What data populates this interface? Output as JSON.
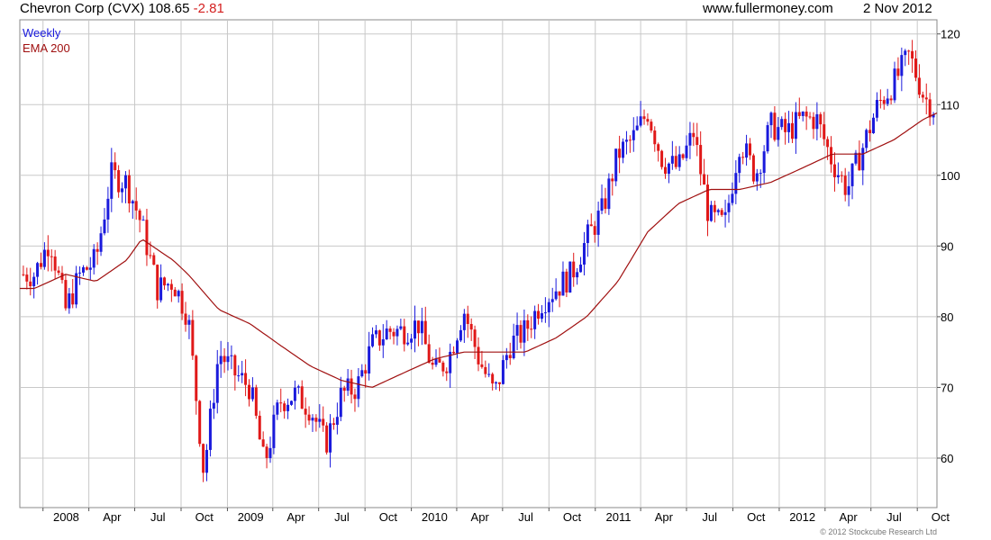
{
  "header": {
    "title": "Chevron Corp (CVX)",
    "price": "108.65",
    "change": "-2.81",
    "source": "www.fullermoney.com",
    "date": "2 Nov 2012"
  },
  "legend": {
    "period": "Weekly",
    "ema": "EMA 200"
  },
  "copyright": "© 2012 Stockcube Research Ltd",
  "colors": {
    "up": "#1a1adc",
    "down": "#e01818",
    "ema": "#a01010",
    "grid": "#c8c8c8",
    "title_change": "#d42020"
  },
  "chart_data": {
    "type": "candlestick",
    "title": "Chevron Corp (CVX)",
    "period": "Weekly",
    "x_tick_labels": [
      "2008",
      "Apr",
      "Jul",
      "Oct",
      "2009",
      "Apr",
      "Jul",
      "Oct",
      "2010",
      "Apr",
      "Jul",
      "Oct",
      "2011",
      "Apr",
      "Jul",
      "Oct",
      "2012",
      "Apr",
      "Jul",
      "Oct"
    ],
    "y_ticks": [
      60,
      70,
      80,
      90,
      100,
      110,
      120
    ],
    "ylim": [
      53,
      122
    ],
    "grid": true,
    "y_axis_side": "right",
    "legend_position": "top-left",
    "close_approx": [
      {
        "x": "2007-12",
        "y": 86
      },
      {
        "x": "2008-01",
        "y": 91
      },
      {
        "x": "2008-02",
        "y": 81
      },
      {
        "x": "2008-03",
        "y": 86
      },
      {
        "x": "2008-04",
        "y": 88
      },
      {
        "x": "2008-05",
        "y": 100
      },
      {
        "x": "2008-06",
        "y": 99
      },
      {
        "x": "2008-07",
        "y": 93
      },
      {
        "x": "2008-08",
        "y": 84
      },
      {
        "x": "2008-09",
        "y": 85
      },
      {
        "x": "2008-10",
        "y": 80
      },
      {
        "x": "2008-11",
        "y": 58
      },
      {
        "x": "2008-12",
        "y": 75
      },
      {
        "x": "2009-01",
        "y": 72
      },
      {
        "x": "2009-02",
        "y": 70
      },
      {
        "x": "2009-03",
        "y": 59
      },
      {
        "x": "2009-04",
        "y": 68
      },
      {
        "x": "2009-05",
        "y": 69
      },
      {
        "x": "2009-06",
        "y": 67
      },
      {
        "x": "2009-07",
        "y": 62
      },
      {
        "x": "2009-08",
        "y": 69
      },
      {
        "x": "2009-09",
        "y": 70
      },
      {
        "x": "2009-10",
        "y": 76
      },
      {
        "x": "2009-11",
        "y": 78
      },
      {
        "x": "2009-12",
        "y": 78
      },
      {
        "x": "2010-01",
        "y": 79
      },
      {
        "x": "2010-02",
        "y": 72
      },
      {
        "x": "2010-03",
        "y": 74
      },
      {
        "x": "2010-04",
        "y": 81
      },
      {
        "x": "2010-05",
        "y": 74
      },
      {
        "x": "2010-06",
        "y": 69
      },
      {
        "x": "2010-07",
        "y": 76
      },
      {
        "x": "2010-08",
        "y": 78
      },
      {
        "x": "2010-09",
        "y": 82
      },
      {
        "x": "2010-10",
        "y": 84
      },
      {
        "x": "2010-11",
        "y": 86
      },
      {
        "x": "2010-12",
        "y": 91
      },
      {
        "x": "2011-01",
        "y": 95
      },
      {
        "x": "2011-02",
        "y": 103
      },
      {
        "x": "2011-03",
        "y": 105
      },
      {
        "x": "2011-04",
        "y": 109
      },
      {
        "x": "2011-05",
        "y": 102
      },
      {
        "x": "2011-06",
        "y": 101
      },
      {
        "x": "2011-07",
        "y": 106
      },
      {
        "x": "2011-08",
        "y": 94
      },
      {
        "x": "2011-09",
        "y": 93
      },
      {
        "x": "2011-10",
        "y": 105
      },
      {
        "x": "2011-11",
        "y": 100
      },
      {
        "x": "2011-12",
        "y": 107
      },
      {
        "x": "2012-01",
        "y": 106
      },
      {
        "x": "2012-02",
        "y": 108
      },
      {
        "x": "2012-03",
        "y": 108
      },
      {
        "x": "2012-04",
        "y": 102
      },
      {
        "x": "2012-05",
        "y": 98
      },
      {
        "x": "2012-06",
        "y": 104
      },
      {
        "x": "2012-07",
        "y": 110
      },
      {
        "x": "2012-08",
        "y": 113
      },
      {
        "x": "2012-09",
        "y": 117
      },
      {
        "x": "2012-10",
        "y": 111
      },
      {
        "x": "2012-11",
        "y": 108.65
      }
    ],
    "ema200_approx": [
      {
        "x": "2007-12",
        "y": 84
      },
      {
        "x": "2008-02",
        "y": 86
      },
      {
        "x": "2008-04",
        "y": 85
      },
      {
        "x": "2008-06",
        "y": 88
      },
      {
        "x": "2008-07",
        "y": 91
      },
      {
        "x": "2008-09",
        "y": 88
      },
      {
        "x": "2008-10",
        "y": 86
      },
      {
        "x": "2008-12",
        "y": 81
      },
      {
        "x": "2009-02",
        "y": 79
      },
      {
        "x": "2009-04",
        "y": 76
      },
      {
        "x": "2009-06",
        "y": 73
      },
      {
        "x": "2009-08",
        "y": 71
      },
      {
        "x": "2009-10",
        "y": 70
      },
      {
        "x": "2009-12",
        "y": 72
      },
      {
        "x": "2010-02",
        "y": 74
      },
      {
        "x": "2010-04",
        "y": 75
      },
      {
        "x": "2010-06",
        "y": 75
      },
      {
        "x": "2010-08",
        "y": 75
      },
      {
        "x": "2010-10",
        "y": 77
      },
      {
        "x": "2010-12",
        "y": 80
      },
      {
        "x": "2011-02",
        "y": 85
      },
      {
        "x": "2011-04",
        "y": 92
      },
      {
        "x": "2011-06",
        "y": 96
      },
      {
        "x": "2011-08",
        "y": 98
      },
      {
        "x": "2011-10",
        "y": 98
      },
      {
        "x": "2011-12",
        "y": 99
      },
      {
        "x": "2012-02",
        "y": 101
      },
      {
        "x": "2012-04",
        "y": 103
      },
      {
        "x": "2012-06",
        "y": 103
      },
      {
        "x": "2012-08",
        "y": 105
      },
      {
        "x": "2012-10",
        "y": 108
      },
      {
        "x": "2012-11",
        "y": 109
      }
    ]
  }
}
